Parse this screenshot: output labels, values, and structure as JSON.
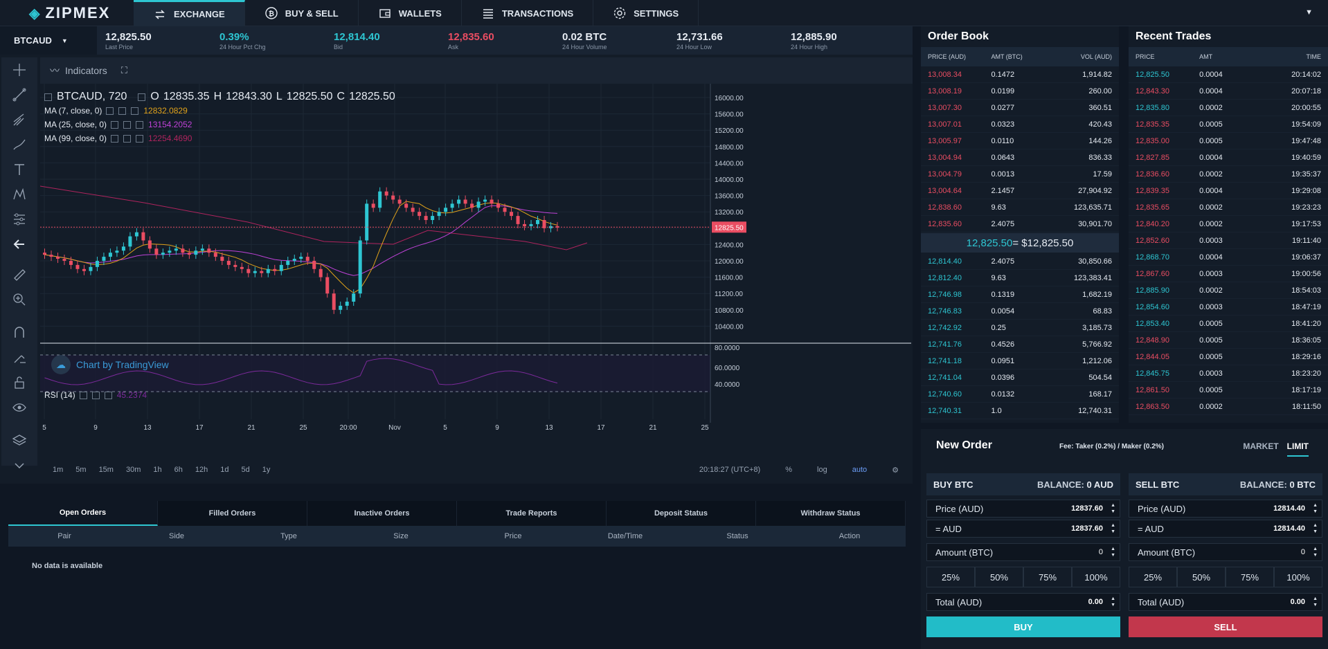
{
  "nav": {
    "logo": "ZIPMEX",
    "tabs": [
      {
        "label": "EXCHANGE",
        "icon": "exchange-icon"
      },
      {
        "label": "BUY & SELL",
        "icon": "bitcoin-icon"
      },
      {
        "label": "WALLETS",
        "icon": "wallet-icon"
      },
      {
        "label": "TRANSACTIONS",
        "icon": "list-icon"
      },
      {
        "label": "SETTINGS",
        "icon": "gear-icon"
      }
    ]
  },
  "ticker": {
    "pair": "BTCAUD",
    "stats": [
      {
        "value": "12,825.50",
        "label": "Last Price"
      },
      {
        "value": "0.39%",
        "label": "24 Hour Pct Chg"
      },
      {
        "value": "12,814.40",
        "label": "Bid"
      },
      {
        "value": "12,835.60",
        "label": "Ask"
      },
      {
        "value": "0.02 BTC",
        "label": "24 Hour Volume"
      },
      {
        "value": "12,731.66",
        "label": "24 Hour Low"
      },
      {
        "value": "12,885.90",
        "label": "24 Hour High"
      }
    ]
  },
  "chart": {
    "indicators_label": "Indicators",
    "symbol": "BTCAUD, 720",
    "ohlc": {
      "o": "12835.35",
      "h": "12843.30",
      "l": "12825.50",
      "c": "12825.50"
    },
    "ma": [
      {
        "label": "MA (7, close, 0)",
        "value": "12832.0829",
        "color": "#e0a21a"
      },
      {
        "label": "MA (25, close, 0)",
        "value": "13154.2052",
        "color": "#c042d8"
      },
      {
        "label": "MA (99, close, 0)",
        "value": "12254.4690",
        "color": "#b0245e"
      }
    ],
    "rsi_label": "RSI (14)",
    "rsi_value": "45.2374",
    "watermark": "Chart by TradingView",
    "last_price_tag": "12825.50",
    "y_ticks": [
      "16000.00",
      "15600.00",
      "15200.00",
      "14800.00",
      "14400.00",
      "14000.00",
      "13600.00",
      "13200.00",
      "12800.00",
      "12400.00",
      "12000.00",
      "11600.00",
      "11200.00",
      "10800.00",
      "10400.00"
    ],
    "rsi_ticks": [
      "80.0000",
      "60.0000",
      "40.0000"
    ],
    "x_ticks": [
      "5",
      "9",
      "13",
      "17",
      "21",
      "25",
      "20:00",
      "Nov",
      "5",
      "9",
      "13",
      "17",
      "21",
      "25"
    ],
    "timeframes": [
      "1m",
      "5m",
      "15m",
      "30m",
      "1h",
      "6h",
      "12h",
      "1d",
      "5d",
      "1y"
    ],
    "clock": "20:18:27 (UTC+8)",
    "opts": [
      "%",
      "log",
      "auto"
    ]
  },
  "orders": {
    "tabs": [
      "Open Orders",
      "Filled Orders",
      "Inactive Orders",
      "Trade Reports",
      "Deposit Status",
      "Withdraw Status"
    ],
    "columns": [
      "Pair",
      "Side",
      "Type",
      "Size",
      "Price",
      "Date/Time",
      "Status",
      "Action"
    ],
    "empty": "No data is available"
  },
  "orderbook": {
    "title": "Order Book",
    "columns": [
      "PRICE (AUD)",
      "AMT (BTC)",
      "VOL (AUD)"
    ],
    "asks": [
      [
        "13,008.34",
        "0.1472",
        "1,914.82"
      ],
      [
        "13,008.19",
        "0.0199",
        "260.00"
      ],
      [
        "13,007.30",
        "0.0277",
        "360.51"
      ],
      [
        "13,007.01",
        "0.0323",
        "420.43"
      ],
      [
        "13,005.97",
        "0.0110",
        "144.26"
      ],
      [
        "13,004.94",
        "0.0643",
        "836.33"
      ],
      [
        "13,004.79",
        "0.0013",
        "17.59"
      ],
      [
        "13,004.64",
        "2.1457",
        "27,904.92"
      ],
      [
        "12,838.60",
        "9.63",
        "123,635.71"
      ],
      [
        "12,835.60",
        "2.4075",
        "30,901.70"
      ]
    ],
    "spread_price": "12,825.50",
    "spread_fiat": " = $12,825.50",
    "bids": [
      [
        "12,814.40",
        "2.4075",
        "30,850.66"
      ],
      [
        "12,812.40",
        "9.63",
        "123,383.41"
      ],
      [
        "12,746.98",
        "0.1319",
        "1,682.19"
      ],
      [
        "12,746.83",
        "0.0054",
        "68.83"
      ],
      [
        "12,742.92",
        "0.25",
        "3,185.73"
      ],
      [
        "12,741.76",
        "0.4526",
        "5,766.92"
      ],
      [
        "12,741.18",
        "0.0951",
        "1,212.06"
      ],
      [
        "12,741.04",
        "0.0396",
        "504.54"
      ],
      [
        "12,740.60",
        "0.0132",
        "168.17"
      ],
      [
        "12,740.31",
        "1.0",
        "12,740.31"
      ]
    ]
  },
  "recent": {
    "title": "Recent Trades",
    "columns": [
      "PRICE",
      "AMT",
      "TIME"
    ],
    "rows": [
      [
        "12,825.50",
        "0.0004",
        "20:14:02",
        "up"
      ],
      [
        "12,843.30",
        "0.0004",
        "20:07:18",
        "down"
      ],
      [
        "12,835.80",
        "0.0002",
        "20:00:55",
        "up"
      ],
      [
        "12,835.35",
        "0.0005",
        "19:54:09",
        "down"
      ],
      [
        "12,835.00",
        "0.0005",
        "19:47:48",
        "down"
      ],
      [
        "12,827.85",
        "0.0004",
        "19:40:59",
        "down"
      ],
      [
        "12,836.60",
        "0.0002",
        "19:35:37",
        "down"
      ],
      [
        "12,839.35",
        "0.0004",
        "19:29:08",
        "down"
      ],
      [
        "12,835.65",
        "0.0002",
        "19:23:23",
        "down"
      ],
      [
        "12,840.20",
        "0.0002",
        "19:17:53",
        "down"
      ],
      [
        "12,852.60",
        "0.0003",
        "19:11:40",
        "down"
      ],
      [
        "12,868.70",
        "0.0004",
        "19:06:37",
        "up"
      ],
      [
        "12,867.60",
        "0.0003",
        "19:00:56",
        "down"
      ],
      [
        "12,885.90",
        "0.0002",
        "18:54:03",
        "up"
      ],
      [
        "12,854.60",
        "0.0003",
        "18:47:19",
        "up"
      ],
      [
        "12,853.40",
        "0.0005",
        "18:41:20",
        "up"
      ],
      [
        "12,848.90",
        "0.0005",
        "18:36:05",
        "down"
      ],
      [
        "12,844.05",
        "0.0005",
        "18:29:16",
        "down"
      ],
      [
        "12,845.75",
        "0.0003",
        "18:23:20",
        "up"
      ],
      [
        "12,861.50",
        "0.0005",
        "18:17:19",
        "down"
      ],
      [
        "12,863.50",
        "0.0002",
        "18:11:50",
        "down"
      ]
    ]
  },
  "neworder": {
    "title": "New Order",
    "fee": "Fee: Taker (0.2%) / Maker (0.2%)",
    "market": "MARKET",
    "limit": "LIMIT",
    "buy": {
      "title": "BUY BTC",
      "balance_label": "BALANCE:",
      "balance": "0 AUD",
      "price_label": "Price (AUD)",
      "price": "12837.60",
      "aud_label": "= AUD",
      "aud": "12837.60",
      "amount_label": "Amount (BTC)",
      "amount": "0",
      "total_label": "Total (AUD)",
      "total": "0.00",
      "button": "BUY"
    },
    "sell": {
      "title": "SELL BTC",
      "balance_label": "BALANCE:",
      "balance": "0 BTC",
      "price_label": "Price (AUD)",
      "price": "12814.40",
      "aud_label": "= AUD",
      "aud": "12814.40",
      "amount_label": "Amount (BTC)",
      "amount": "0",
      "total_label": "Total (AUD)",
      "total": "0.00",
      "button": "SELL"
    },
    "percents": [
      "25%",
      "50%",
      "75%",
      "100%"
    ]
  },
  "colors": {
    "accent": "#2ec6d2",
    "up": "#2ec6d2",
    "down": "#ea4d62",
    "buy": "#22bcc8",
    "sell": "#c2374c"
  }
}
